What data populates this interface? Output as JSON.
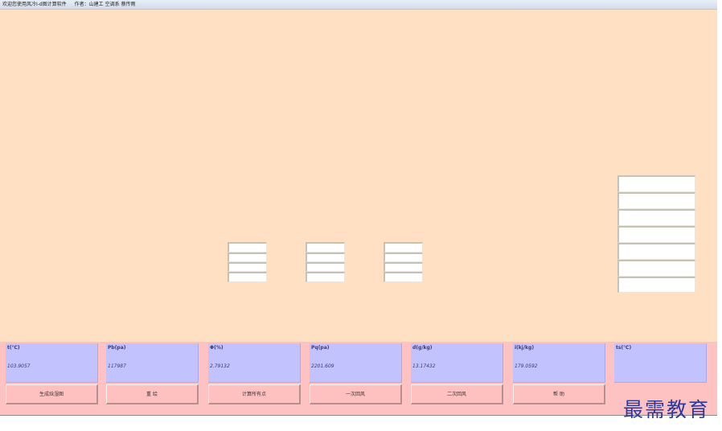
{
  "window": {
    "title": "欢迎您使用风冷I-d图计算软件",
    "authors": "作者：山建工 空调系 蔡传雨"
  },
  "params": [
    {
      "label": "t(℃)",
      "value": "103.9057"
    },
    {
      "label": "Pb(pa)",
      "value": "117987"
    },
    {
      "label": "Φ(%)",
      "value": "2.79132"
    },
    {
      "label": "Pq(pa)",
      "value": "2201.609"
    },
    {
      "label": "d(g/kg)",
      "value": "13.17432"
    },
    {
      "label": "i(kj/kg)",
      "value": "179.0592"
    },
    {
      "label": "ts(℃)",
      "value": ""
    }
  ],
  "buttons": [
    "生成焓湿图",
    "重 绘",
    "计算所有点",
    "一次回风",
    "二次回风",
    "帮 助"
  ],
  "watermark": "最需教育"
}
